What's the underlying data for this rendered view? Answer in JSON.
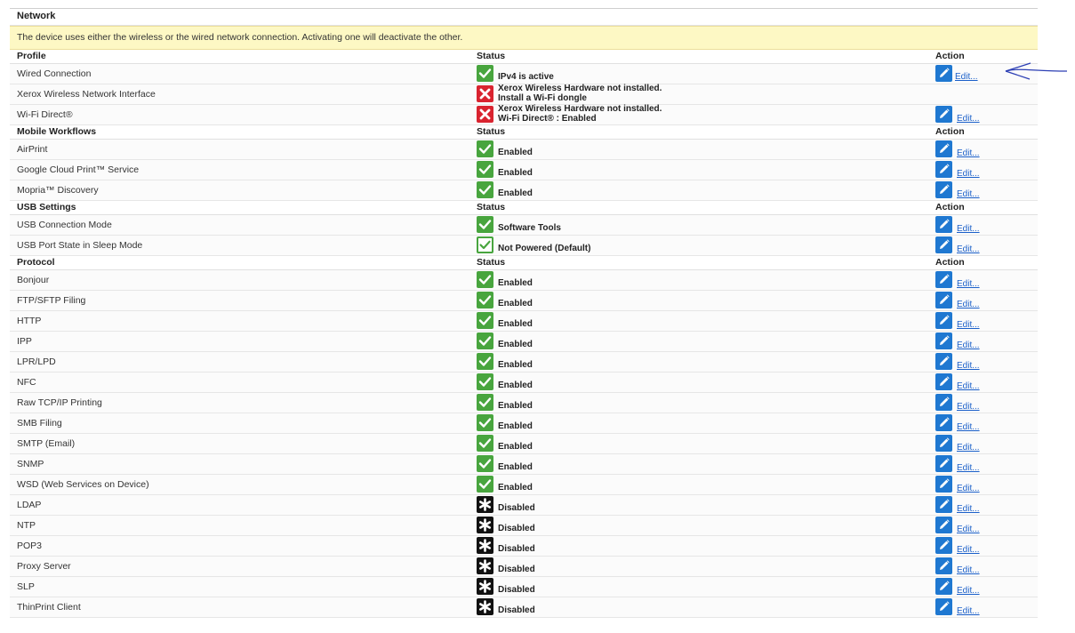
{
  "title": "Network",
  "notice": "The device uses either the wireless or the wired network connection. Activating one will deactivate the other.",
  "colors": {
    "ok": "#48a53e",
    "error": "#d9232f",
    "disabled": "#111111",
    "edit": "#1f78d1",
    "link": "#1a5fc9",
    "notice_bg": "#fdf8c4",
    "annotation_arrow": "#2c3fb4"
  },
  "rows": [
    {
      "kind": "header",
      "label": "Profile",
      "status": "Status",
      "action": "Action"
    },
    {
      "kind": "data",
      "label": "Wired Connection",
      "icon": "check-icon",
      "status": "IPv4 is active",
      "action": "Edit..."
    },
    {
      "kind": "data",
      "label": "Xerox Wireless Network Interface",
      "icon": "error-icon",
      "status": "Xerox Wireless Hardware not installed.",
      "status2": "Install a Wi-Fi dongle"
    },
    {
      "kind": "data",
      "label": "Wi-Fi Direct®",
      "icon": "error-icon",
      "status": "Xerox Wireless Hardware not installed.",
      "status2": "Wi-Fi Direct® : Enabled",
      "action": "Edit..."
    },
    {
      "kind": "header",
      "label": "Mobile Workflows",
      "status": "Status",
      "action": "Action"
    },
    {
      "kind": "data",
      "label": "AirPrint",
      "icon": "check-icon",
      "status": "Enabled",
      "action": "Edit..."
    },
    {
      "kind": "data",
      "label": "Google Cloud Print™ Service",
      "icon": "check-icon",
      "status": "Enabled",
      "action": "Edit..."
    },
    {
      "kind": "data",
      "label": "Mopria™ Discovery",
      "icon": "check-icon",
      "status": "Enabled",
      "action": "Edit..."
    },
    {
      "kind": "header",
      "label": "USB Settings",
      "status": "Status",
      "action": "Action"
    },
    {
      "kind": "data",
      "label": "USB Connection Mode",
      "icon": "check-icon",
      "status": "Software Tools",
      "action": "Edit..."
    },
    {
      "kind": "data",
      "label": "USB Port State in Sleep Mode",
      "icon": "check-outline-icon",
      "status": "Not Powered (Default)",
      "action": "Edit..."
    },
    {
      "kind": "header",
      "label": "Protocol",
      "status": "Status",
      "action": "Action"
    },
    {
      "kind": "data",
      "label": "Bonjour",
      "icon": "check-icon",
      "status": "Enabled",
      "action": "Edit..."
    },
    {
      "kind": "data",
      "label": "FTP/SFTP Filing",
      "icon": "check-icon",
      "status": "Enabled",
      "action": "Edit..."
    },
    {
      "kind": "data",
      "label": "HTTP",
      "icon": "check-icon",
      "status": "Enabled",
      "action": "Edit..."
    },
    {
      "kind": "data",
      "label": "IPP",
      "icon": "check-icon",
      "status": "Enabled",
      "action": "Edit..."
    },
    {
      "kind": "data",
      "label": "LPR/LPD",
      "icon": "check-icon",
      "status": "Enabled",
      "action": "Edit..."
    },
    {
      "kind": "data",
      "label": "NFC",
      "icon": "check-icon",
      "status": "Enabled",
      "action": "Edit..."
    },
    {
      "kind": "data",
      "label": "Raw TCP/IP Printing",
      "icon": "check-icon",
      "status": "Enabled",
      "action": "Edit..."
    },
    {
      "kind": "data",
      "label": "SMB Filing",
      "icon": "check-icon",
      "status": "Enabled",
      "action": "Edit..."
    },
    {
      "kind": "data",
      "label": "SMTP (Email)",
      "icon": "check-icon",
      "status": "Enabled",
      "action": "Edit..."
    },
    {
      "kind": "data",
      "label": "SNMP",
      "icon": "check-icon",
      "status": "Enabled",
      "action": "Edit..."
    },
    {
      "kind": "data",
      "label": "WSD (Web Services on Device)",
      "icon": "check-icon",
      "status": "Enabled",
      "action": "Edit..."
    },
    {
      "kind": "data",
      "label": "LDAP",
      "icon": "asterisk-icon",
      "status": "Disabled",
      "action": "Edit..."
    },
    {
      "kind": "data",
      "label": "NTP",
      "icon": "asterisk-icon",
      "status": "Disabled",
      "action": "Edit..."
    },
    {
      "kind": "data",
      "label": "POP3",
      "icon": "asterisk-icon",
      "status": "Disabled",
      "action": "Edit..."
    },
    {
      "kind": "data",
      "label": "Proxy Server",
      "icon": "asterisk-icon",
      "status": "Disabled",
      "action": "Edit..."
    },
    {
      "kind": "data",
      "label": "SLP",
      "icon": "asterisk-icon",
      "status": "Disabled",
      "action": "Edit..."
    },
    {
      "kind": "data",
      "label": "ThinPrint Client",
      "icon": "asterisk-icon",
      "status": "Disabled",
      "action": "Edit..."
    }
  ]
}
